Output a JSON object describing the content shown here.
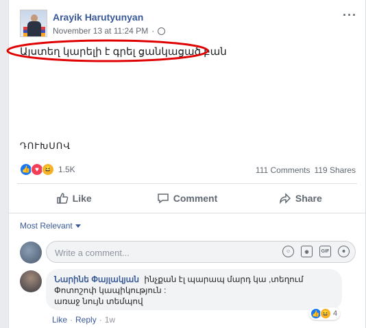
{
  "post": {
    "author": "Arayik Harutyunyan",
    "timestamp": "November 13 at 11:24 PM",
    "privacy_sep": "·",
    "more_label": "···",
    "text": "Այստեղ կարելի է գրել ցանկացած բան",
    "signature": "ԴՈՒԽՍՈՎ",
    "reaction_count": "1.5K",
    "comments_count": "111 Comments",
    "shares_count": "119 Shares",
    "accent_color": "#385898",
    "highlight_color": "#e00000"
  },
  "actions": {
    "like": "Like",
    "comment": "Comment",
    "share": "Share"
  },
  "comments_section": {
    "sort_label": "Most Relevant",
    "write_placeholder": "Write a comment...",
    "write_icons": [
      "emoji-icon",
      "camera-icon",
      "gif-icon",
      "sticker-icon"
    ],
    "comment": {
      "author": "Նարինե Փայլակյան",
      "text_line1": "ինչքան էլ պարապ մարդ կա ,տեղում Փոտոշոփ կապիկություն :",
      "text_line2": "առաջ նույն տեմպով",
      "reaction_count": "4",
      "like_label": "Like",
      "reply_label": "Reply",
      "sep": "·",
      "age": "1w"
    }
  }
}
